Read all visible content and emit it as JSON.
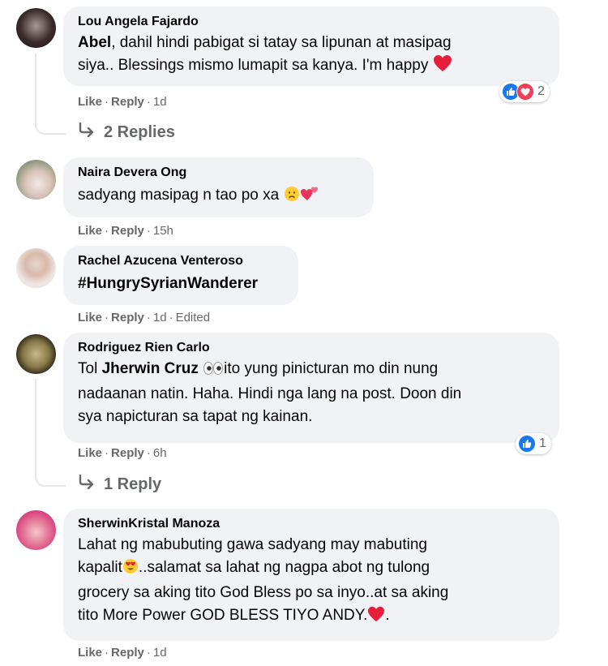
{
  "comments": [
    {
      "author": "Lou Angela Fajardo",
      "mention": "Abel",
      "text_line1": ", dahil hindi pabigat si tatay sa lipunan at masipag",
      "text_line2": "siya.. Blessings mismo lumapit sa kanya. I'm happy",
      "like": "Like",
      "reply": "Reply",
      "time": "1d",
      "reaction_count": "2",
      "replies_label": "2 Replies"
    },
    {
      "author": "Naira Devera Ong",
      "text": "sadyang masipag n tao po xa",
      "like": "Like",
      "reply": "Reply",
      "time": "15h"
    },
    {
      "author": "Rachel Azucena Venteroso",
      "text": "#HungrySyrianWanderer",
      "like": "Like",
      "reply": "Reply",
      "time": "1d",
      "edited": "Edited"
    },
    {
      "author": "Rodriguez Rien Carlo",
      "text_prefix": "Tol ",
      "mention": "Jherwin Cruz",
      "text_line1": "ito yung pinicturan mo din nung",
      "text_line2": "nadaanan natin. Haha. Hindi nga lang na post. Doon din",
      "text_line3": "sya napicturan sa tapat ng kainan.",
      "like": "Like",
      "reply": "Reply",
      "time": "6h",
      "reaction_count": "1",
      "replies_label": "1 Reply"
    },
    {
      "author": "SherwinKristal Manoza",
      "text_line1": "Lahat ng mabubuting gawa sadyang may mabuting",
      "text_line2": "kapalit",
      "text_line2b": "..salamat sa lahat ng nagpa abot ng tulong",
      "text_line3": "grocery sa aking tito God Bless po sa inyo..at sa aking",
      "text_line4": "tito More Power GOD BLESS TIYO ANDY.",
      "text_line4b": ".",
      "like": "Like",
      "reply": "Reply",
      "time": "1d"
    }
  ],
  "colors": {
    "bubble": "#f0f2f5",
    "meta": "#65676b",
    "like_blue": "#1877f2",
    "love_red": "#f33e58"
  }
}
